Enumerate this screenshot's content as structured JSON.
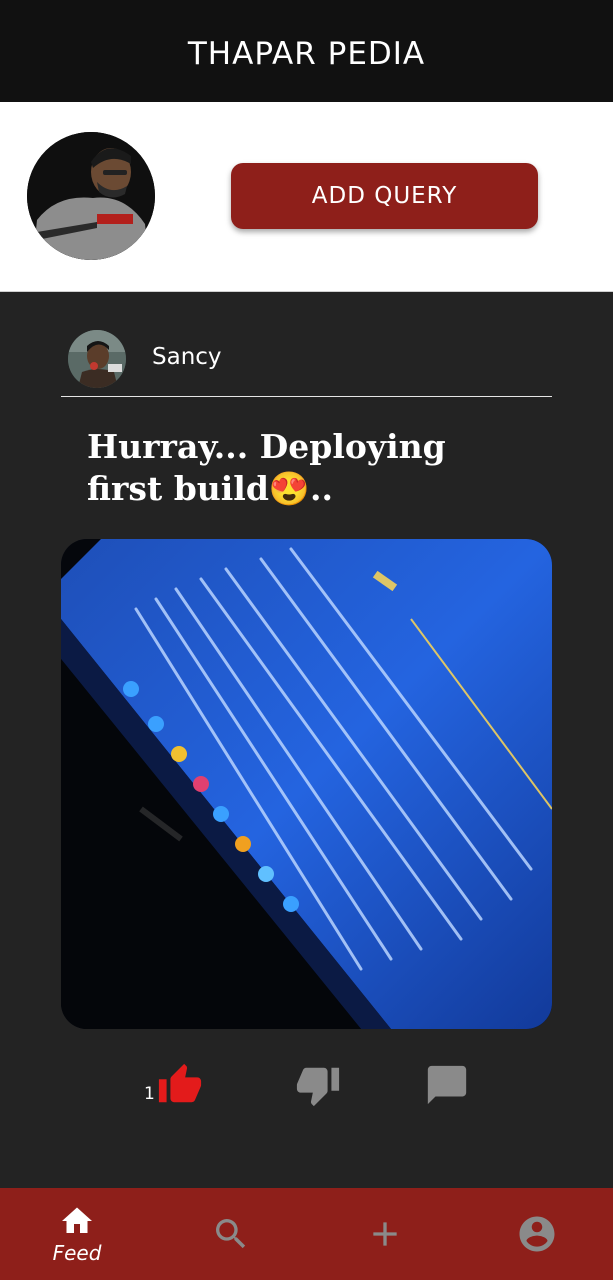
{
  "app": {
    "title": "THAPAR PEDIA"
  },
  "profile": {
    "add_query_label": "ADD QUERY"
  },
  "post": {
    "author": "Sancy",
    "title": "Hurray... Deploying first build😍..",
    "likes": "1"
  },
  "bottom_nav": {
    "items": [
      {
        "label": "Feed",
        "icon": "home-icon",
        "active": true
      },
      {
        "label": "",
        "icon": "search-icon",
        "active": false
      },
      {
        "label": "",
        "icon": "add-icon",
        "active": false
      },
      {
        "label": "",
        "icon": "account-icon",
        "active": false
      }
    ]
  },
  "colors": {
    "brand_red": "#8e1f1a",
    "like_red": "#e31b1b",
    "inactive_icon": "#8a8a8a",
    "feed_bg": "#232323",
    "header_bg": "#111111"
  }
}
